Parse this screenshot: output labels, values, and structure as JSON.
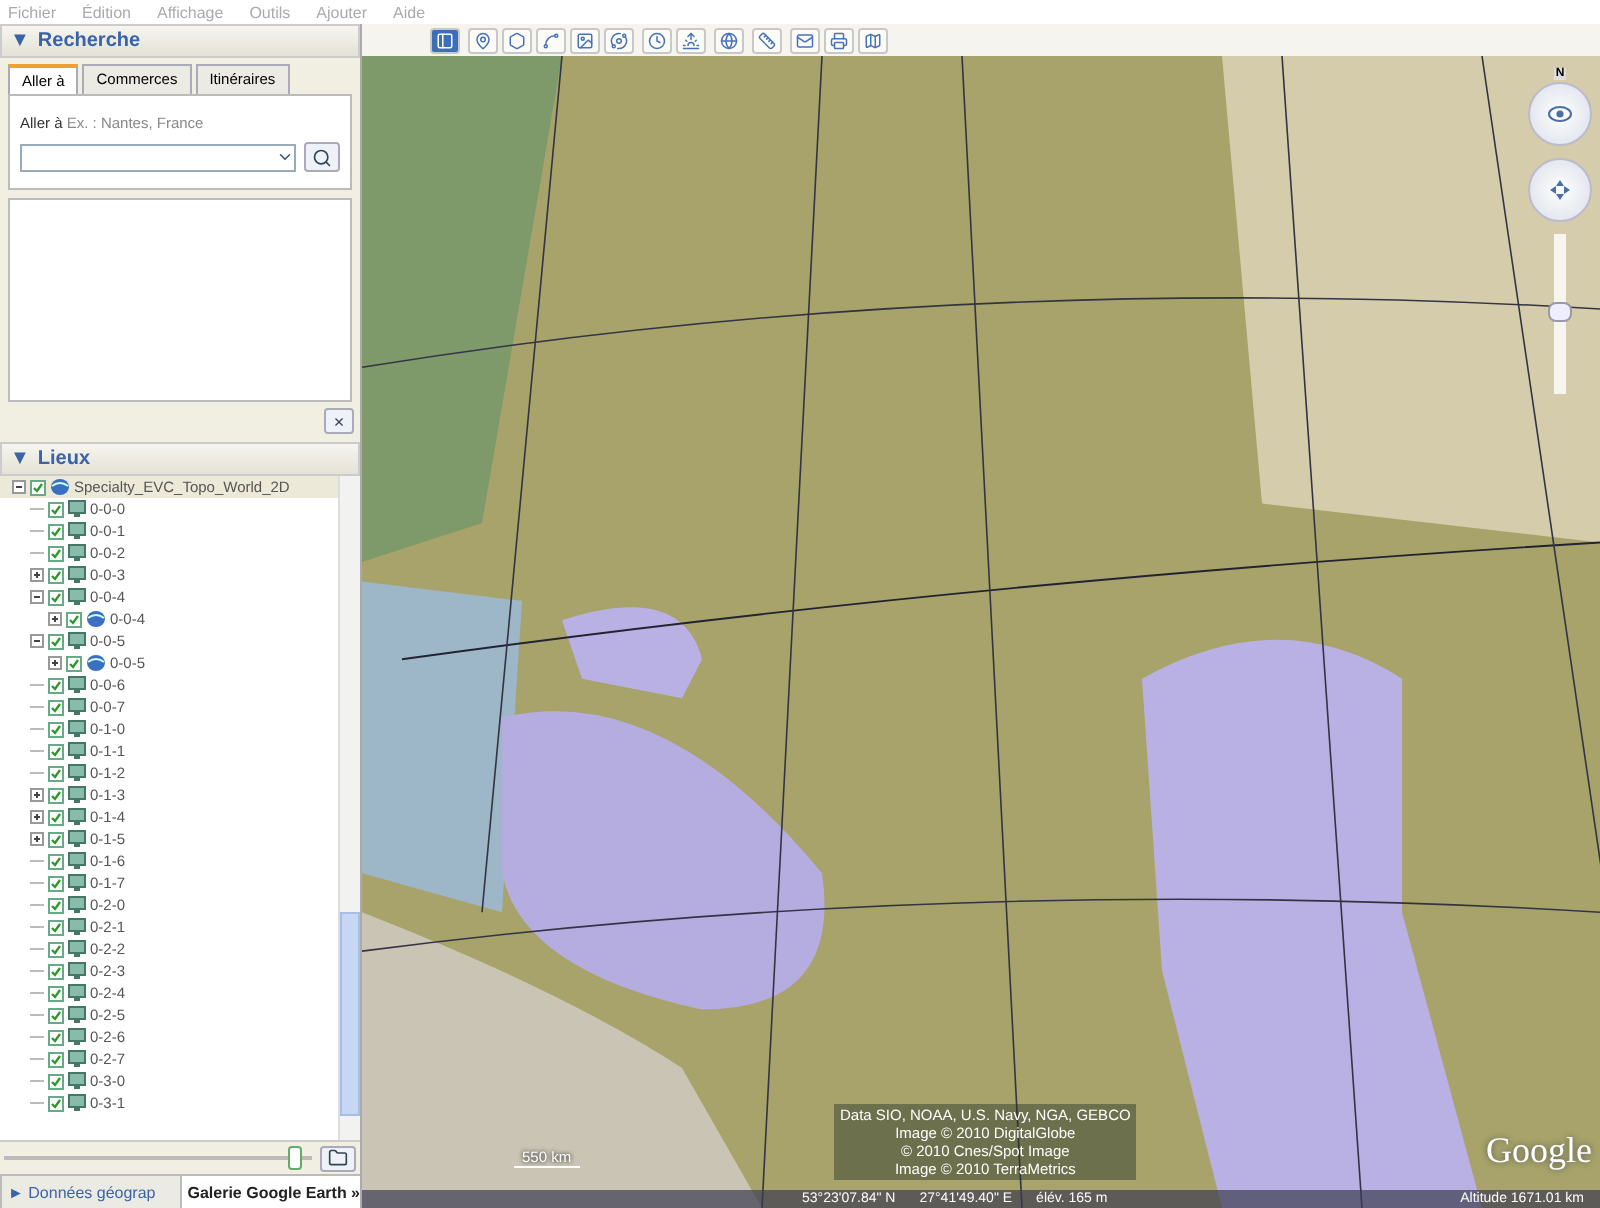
{
  "menu": [
    "Fichier",
    "Édition",
    "Affichage",
    "Outils",
    "Ajouter",
    "Aide"
  ],
  "search": {
    "header": {
      "arrow": "▼",
      "title": "Recherche"
    },
    "tabs": [
      {
        "label": "Aller à",
        "selected": true
      },
      {
        "label": "Commerces",
        "selected": false
      },
      {
        "label": "Itinéraires",
        "selected": false
      }
    ],
    "label": "Aller à",
    "hint": "Ex. : Nantes, France",
    "close": "×"
  },
  "places": {
    "header": {
      "arrow": "▼",
      "title": "Lieux"
    },
    "tree": [
      {
        "label": "Specialty_EVC_Topo_World_2D",
        "kind": "globe",
        "checked": true,
        "expanded": true,
        "children": [
          {
            "label": "0-0-0",
            "kind": "layer",
            "checked": true
          },
          {
            "label": "0-0-1",
            "kind": "layer",
            "checked": true
          },
          {
            "label": "0-0-2",
            "kind": "layer",
            "checked": true
          },
          {
            "label": "0-0-3",
            "kind": "layer",
            "checked": true,
            "expanded": false
          },
          {
            "label": "0-0-4",
            "kind": "layer",
            "checked": true,
            "expanded": true,
            "children": [
              {
                "label": "0-0-4",
                "kind": "globe",
                "checked": true,
                "expanded": false
              }
            ]
          },
          {
            "label": "0-0-5",
            "kind": "layer",
            "checked": true,
            "expanded": true,
            "children": [
              {
                "label": "0-0-5",
                "kind": "globe",
                "checked": true,
                "expanded": false
              }
            ]
          },
          {
            "label": "0-0-6",
            "kind": "layer",
            "checked": true
          },
          {
            "label": "0-0-7",
            "kind": "layer",
            "checked": true
          },
          {
            "label": "0-1-0",
            "kind": "layer",
            "checked": true
          },
          {
            "label": "0-1-1",
            "kind": "layer",
            "checked": true
          },
          {
            "label": "0-1-2",
            "kind": "layer",
            "checked": true
          },
          {
            "label": "0-1-3",
            "kind": "layer",
            "checked": true,
            "expanded": false
          },
          {
            "label": "0-1-4",
            "kind": "layer",
            "checked": true,
            "expanded": false
          },
          {
            "label": "0-1-5",
            "kind": "layer",
            "checked": true,
            "expanded": false
          },
          {
            "label": "0-1-6",
            "kind": "layer",
            "checked": true
          },
          {
            "label": "0-1-7",
            "kind": "layer",
            "checked": true
          },
          {
            "label": "0-2-0",
            "kind": "layer",
            "checked": true
          },
          {
            "label": "0-2-1",
            "kind": "layer",
            "checked": true
          },
          {
            "label": "0-2-2",
            "kind": "layer",
            "checked": true
          },
          {
            "label": "0-2-3",
            "kind": "layer",
            "checked": true
          },
          {
            "label": "0-2-4",
            "kind": "layer",
            "checked": true
          },
          {
            "label": "0-2-5",
            "kind": "layer",
            "checked": true
          },
          {
            "label": "0-2-6",
            "kind": "layer",
            "checked": true
          },
          {
            "label": "0-2-7",
            "kind": "layer",
            "checked": true
          },
          {
            "label": "0-3-0",
            "kind": "layer",
            "checked": true
          },
          {
            "label": "0-3-1",
            "kind": "layer",
            "checked": true
          }
        ]
      }
    ],
    "opacity": {
      "level": 0.97
    }
  },
  "bottom_tabs": [
    {
      "label": "► Données géograp",
      "selected": false
    },
    {
      "label": "Galerie Google Earth »",
      "selected": true
    }
  ],
  "map": {
    "compass": "N",
    "zoom": {
      "level": 0.5
    },
    "attribution": [
      "Data SIO, NOAA, U.S. Navy, NGA, GEBCO",
      "Image © 2010 DigitalGlobe",
      "© 2010 Cnes/Spot Image",
      "Image © 2010 TerraMetrics"
    ],
    "scale": "550 km",
    "logo": "Google",
    "status": {
      "lat": "53°23'07.84\" N",
      "lon": "27°41'49.40\" E",
      "elev": "élév. 165 m",
      "altitude": "Altitude 1671.01 km"
    }
  }
}
